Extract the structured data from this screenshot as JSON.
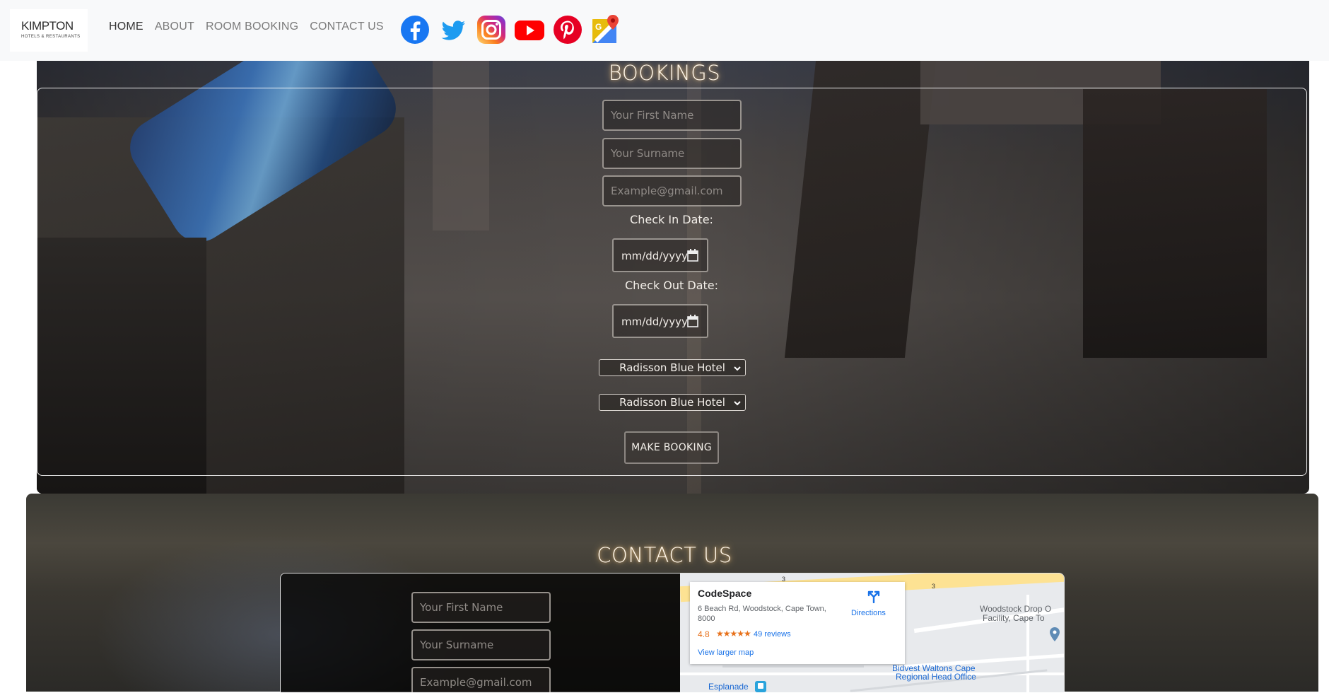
{
  "nav": {
    "logo_text": "KIMPTON",
    "logo_subtext": "HOTELS & RESTAURANTS",
    "links": [
      "HOME",
      "ABOUT",
      "ROOM BOOKING",
      "CONTACT US"
    ],
    "socials": [
      "facebook-icon",
      "twitter-icon",
      "instagram-icon",
      "youtube-icon",
      "pinterest-icon",
      "google-maps-icon"
    ]
  },
  "bookings": {
    "title": "BOOKINGS",
    "first_name_placeholder": "Your First Name",
    "surname_placeholder": "Your Surname",
    "email_placeholder": "Example@gmail.com",
    "check_in_label": "Check In Date:",
    "check_in_value": "mm/dd/yyyy",
    "check_out_label": "Check Out Date:",
    "check_out_value": "mm/dd/yyyy",
    "hotel_select_1": "Radisson Blue Hotel",
    "hotel_select_2": "Radisson Blue Hotel",
    "submit_label": "MAKE BOOKING"
  },
  "contact": {
    "title": "CONTACT US",
    "first_name_placeholder": "Your First Name",
    "surname_placeholder": "Your Surname",
    "email_placeholder": "Example@gmail.com"
  },
  "map": {
    "place_name": "CodeSpace",
    "address": "6 Beach Rd, Woodstock, Cape Town, 8000",
    "rating": "4.8",
    "stars": "★★★★★",
    "reviews": "49 reviews",
    "directions": "Directions",
    "larger_map": "View larger map",
    "label_woodstock_line1": "Woodstock Drop O",
    "label_woodstock_line2": "Facility, Cape To",
    "label_bidvest_line1": "Bidvest Waltons Cape",
    "label_bidvest_line2": "Regional Head Office",
    "label_esplanade": "Esplanade",
    "road_number_1": "3",
    "road_number_2": "3"
  },
  "colors": {
    "nav_bg": "#f8f9fa",
    "title_glow": "#ffd28c",
    "map_link": "#1a73e8",
    "rating": "#e7711b"
  }
}
